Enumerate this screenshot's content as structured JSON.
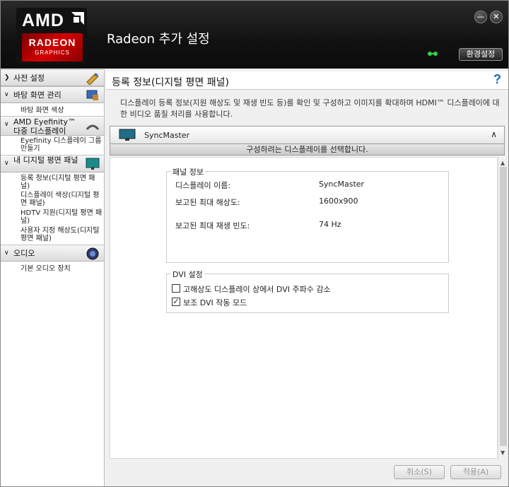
{
  "app": {
    "title": "Radeon 추가 설정",
    "pref_label": "환경설정",
    "min_glyph": "—",
    "close_glyph": "✕"
  },
  "logo": {
    "amd": "AMD",
    "radeon": "RADEON",
    "graphics": "GRAPHICS"
  },
  "sidebar": {
    "sections": [
      {
        "label": "사전 설정",
        "icon": "preset-icon",
        "items": []
      },
      {
        "label": "바탕 화면 관리",
        "icon": "desktop-management-icon",
        "items": [
          {
            "label": "바탕 화면 색상"
          }
        ]
      },
      {
        "label": "AMD Eyefinity™ 다중 디스플레이",
        "icon": "eyefinity-icon",
        "items": [
          {
            "label": "Eyefinity 디스플레이 그룹 만들기"
          }
        ]
      },
      {
        "label": "내 디지털 평면 패널",
        "icon": "flat-panel-icon",
        "items": [
          {
            "label": "등록 정보(디지털 평면 패널)"
          },
          {
            "label": "디스플레이 색상(디지털 평면 패널)"
          },
          {
            "label": "HDTV 지원(디지털 평면 패널)"
          },
          {
            "label": "사용자 지정 해상도(디지털 평면 패널)"
          }
        ]
      },
      {
        "label": "오디오",
        "icon": "audio-icon",
        "items": [
          {
            "label": "기본 오디오 장치"
          }
        ]
      }
    ]
  },
  "main": {
    "title": "등록 정보(디지털 평면 패널)",
    "help": "?",
    "description": "디스플레이 등록 정보(지원 해상도 및 재생 빈도 등)를 확인 및 구성하고 이미지를 확대하며 HDMI™ 디스플레이에 대한 비디오 품질 처리를 사용합니다.",
    "display": {
      "name": "SyncMaster",
      "select_hint": "구성하려는 디스플레이를 선택합니다."
    },
    "panel_info": {
      "title": "패널 정보",
      "rows": [
        {
          "label": "디스플레이 이름:",
          "value": "SyncMaster"
        },
        {
          "label": "보고된 최대 해상도:",
          "value": "1600x900"
        },
        {
          "label": "보고된 최대 재생 빈도:",
          "value": "74 Hz"
        }
      ]
    },
    "dvi": {
      "title": "DVI 설정",
      "options": [
        {
          "label": "고해상도 디스플레이 상에서 DVI 주파수 감소",
          "checked": false
        },
        {
          "label": "보조 DVI 작동 모드",
          "checked": true
        }
      ]
    },
    "buttons": {
      "cancel": "취소(S)",
      "apply": "적용(A)"
    }
  }
}
